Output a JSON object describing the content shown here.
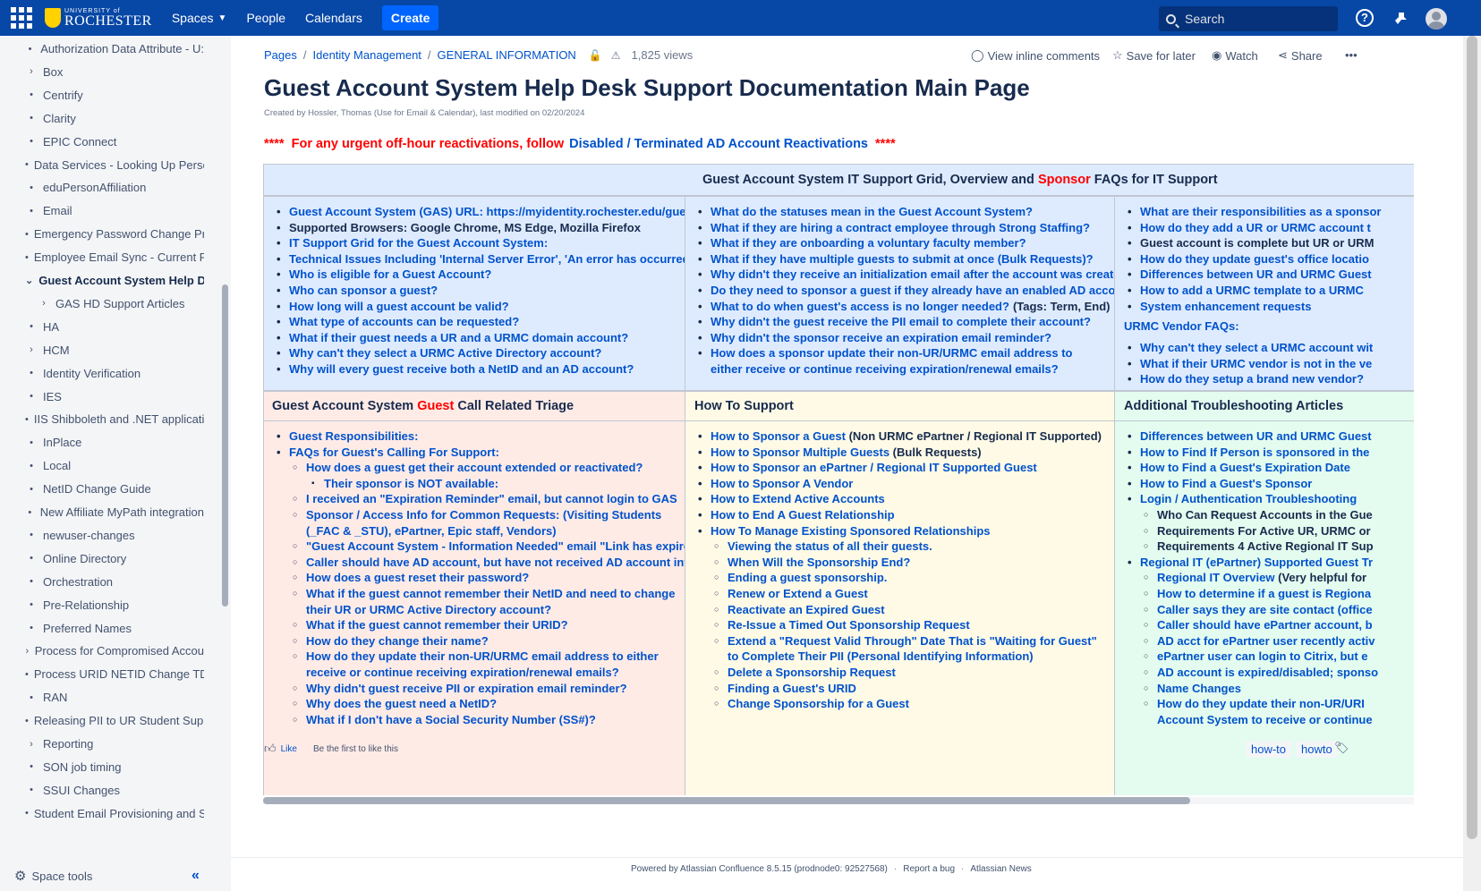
{
  "topbar": {
    "logo_small": "UNIVERSITY of",
    "logo_big": "ROCHESTER",
    "nav": [
      "Spaces",
      "People",
      "Calendars"
    ],
    "create": "Create",
    "search_placeholder": "Search",
    "help": "?"
  },
  "sidebar": {
    "items": [
      {
        "label": "Authorization Data Attribute - U:",
        "marker": "•"
      },
      {
        "label": "Box",
        "marker": "›"
      },
      {
        "label": "Centrify",
        "marker": "•"
      },
      {
        "label": "Clarity",
        "marker": "•"
      },
      {
        "label": "EPIC Connect",
        "marker": "•"
      },
      {
        "label": "Data Services - Looking Up Persc",
        "marker": "•"
      },
      {
        "label": "eduPersonAffiliation",
        "marker": "•"
      },
      {
        "label": "Email",
        "marker": "•"
      },
      {
        "label": "Emergency Password Change Pr",
        "marker": "•"
      },
      {
        "label": "Employee Email Sync - Current P",
        "marker": "•"
      },
      {
        "label": "Guest Account System Help De",
        "marker": "⌄",
        "active": true
      },
      {
        "label": "GAS HD Support Articles",
        "marker": "›",
        "child": true
      },
      {
        "label": "HA",
        "marker": "•"
      },
      {
        "label": "HCM",
        "marker": "›"
      },
      {
        "label": "Identity Verification",
        "marker": "•"
      },
      {
        "label": "IES",
        "marker": "•"
      },
      {
        "label": "IIS Shibboleth and .NET applicati",
        "marker": "•"
      },
      {
        "label": "InPlace",
        "marker": "•"
      },
      {
        "label": "Local",
        "marker": "•"
      },
      {
        "label": "NetID Change Guide",
        "marker": "•"
      },
      {
        "label": "New Affiliate MyPath integration",
        "marker": "•"
      },
      {
        "label": "newuser-changes",
        "marker": "•"
      },
      {
        "label": "Online Directory",
        "marker": "•"
      },
      {
        "label": "Orchestration",
        "marker": "•"
      },
      {
        "label": "Pre-Relationship",
        "marker": "•"
      },
      {
        "label": "Preferred Names",
        "marker": "•"
      },
      {
        "label": "Process for Compromised Accou",
        "marker": "›"
      },
      {
        "label": "Process URID NETID Change TDI",
        "marker": "•"
      },
      {
        "label": "RAN",
        "marker": "•"
      },
      {
        "label": "Releasing PII to UR Student Supp",
        "marker": "•"
      },
      {
        "label": "Reporting",
        "marker": "›"
      },
      {
        "label": "SON job timing",
        "marker": "•"
      },
      {
        "label": "SSUI Changes",
        "marker": "•"
      },
      {
        "label": "Student Email Provisioning and S",
        "marker": "•"
      }
    ],
    "space_tools": "Space tools",
    "collapse": "«"
  },
  "breadcrumb": {
    "items": [
      "Pages",
      "Identity Management",
      "GENERAL INFORMATION"
    ],
    "views": "1,825 views"
  },
  "page_actions": {
    "inline_comments": "View inline comments",
    "save_later": "Save for later",
    "watch": "Watch",
    "share": "Share",
    "more": "•••"
  },
  "page": {
    "title": "Guest Account System Help Desk Support Documentation Main Page",
    "byline": "Created by Hossler, Thomas (Use for Email & Calendar), last modified on 02/20/2024",
    "alert_stars": "****",
    "alert_text": "For any urgent off-hour reactivations, follow",
    "alert_link": "Disabled / Terminated AD Account Reactivations",
    "alert_stars_end": "****"
  },
  "grid": {
    "header_pre": "Guest Account System IT Support Grid, Overview and ",
    "header_red": "Sponsor",
    "header_post": " FAQs for IT Support",
    "col1": [
      "Guest Account System (GAS) URL:   https://myidentity.rochester.edu/guest/",
      "Supported Browsers:  Google Chrome, MS Edge, Mozilla Firefox",
      "IT Support Grid for the Guest Account System:",
      "Technical Issues Including 'Internal Server Error', 'An error has occurred..'",
      "Who is eligible for a Guest Account?",
      "Who can sponsor a guest?",
      "How long will a guest account be valid?",
      "What type of accounts can be requested?",
      "What if their guest needs a UR and a URMC domain account?",
      "Why can't they select a URMC Active Directory account?",
      "Why will every guest receive both a NetID and an AD account?"
    ],
    "col2": [
      "What do the statuses mean in the Guest Account System?",
      "What if they are hiring a contract employee through Strong Staffing?",
      "What if they are onboarding a voluntary faculty member?",
      "What if they have multiple guests to submit at once (Bulk Requests)?",
      "Why didn't they receive an initialization email after the account was created?",
      "Do they need to sponsor a guest if they already have an enabled AD account?",
      "What to do when guest's access is no longer needed?",
      "Why didn't the guest receive the PII email to complete their account?",
      "Why didn't the sponsor receive an expiration email reminder?",
      "How does a sponsor update their non-UR/URMC email address to either receive or continue receiving expiration/renewal emails?"
    ],
    "col2_tags": "(Tags: Term, End)",
    "col3": [
      "What are their responsibilities as a sponsor",
      "How do they add a UR or URMC account t",
      "Guest account is complete but UR or URM",
      "How do they update guest's office locatio",
      "Differences between UR and URMC Guest",
      "How to add a URMC template to a URMC",
      "System enhancement requests"
    ],
    "col3_sub": "URMC Vendor FAQs:",
    "col3b": [
      "Why can't they select a URMC account wit",
      "What if their URMC vendor is not in the ve",
      "How do they setup a brand new vendor?"
    ]
  },
  "triage": {
    "title_pre": "Guest Account System ",
    "title_red": "Guest",
    "title_post": " Call Related Triage",
    "items": [
      {
        "t": "Guest Responsibilities:",
        "lvl": 1
      },
      {
        "t": "FAQs for Guest's Calling For Support:",
        "lvl": 1
      },
      {
        "t": "How does a guest get their account extended or reactivated?",
        "lvl": 2
      },
      {
        "t": "Their sponsor is NOT available:",
        "lvl": 3
      },
      {
        "t": "I received an \"Expiration Reminder\" email, but cannot login to GAS",
        "lvl": 2
      },
      {
        "t": "Sponsor / Access Info for Common Requests: (Visiting Students (_FAC & _STU), ePartner, Epic staff, Vendors)",
        "lvl": 2,
        "wrap": true
      },
      {
        "t": "\"Guest Account System - Information Needed\" email \"Link has expired\"",
        "lvl": 2
      },
      {
        "t": "Caller should have AD account, but have not received AD account info",
        "lvl": 2
      },
      {
        "t": "How does a guest reset their password?",
        "lvl": 2
      },
      {
        "t": "What if the guest cannot remember their NetID and need to change their UR or URMC Active Directory account?",
        "lvl": 2,
        "wrap": true
      },
      {
        "t": "What if the guest cannot remember their URID?",
        "lvl": 2
      },
      {
        "t": "How do they change their name?",
        "lvl": 2
      },
      {
        "t": "How do they update their non-UR/URMC email address to either receive or continue receiving expiration/renewal emails?",
        "lvl": 2,
        "wrap": true
      },
      {
        "t": "Why didn't guest receive PII or expiration email reminder?",
        "lvl": 2
      },
      {
        "t": "Why does the guest need a NetID?",
        "lvl": 2
      },
      {
        "t": "What if I don't have a Social Security Number (SS#)?",
        "lvl": 2
      }
    ]
  },
  "howto": {
    "title": "How To Support",
    "items": [
      {
        "t": "How to Sponsor a Guest",
        "dark": " (Non URMC ePartner / Regional IT Supported)",
        "lvl": 1
      },
      {
        "t": "How to Sponsor Multiple Guests",
        "dark": " (Bulk Requests)",
        "lvl": 1
      },
      {
        "t": "How to Sponsor an ePartner / Regional IT Supported Guest",
        "lvl": 1
      },
      {
        "t": "How to Sponsor A Vendor",
        "lvl": 1
      },
      {
        "t": "How to Extend Active Accounts",
        "lvl": 1
      },
      {
        "t": "How to End A Guest Relationship",
        "lvl": 1
      },
      {
        "t": "How To Manage Existing Sponsored Relationships",
        "lvl": 1
      },
      {
        "t": "Viewing the status of all their guests.",
        "lvl": 2
      },
      {
        "t": "When Will the Sponsorship End?",
        "lvl": 2
      },
      {
        "t": "Ending a guest sponsorship.",
        "lvl": 2
      },
      {
        "t": "Renew or Extend a Guest",
        "lvl": 2
      },
      {
        "t": "Reactivate an Expired Guest",
        "lvl": 2
      },
      {
        "t": "Re-Issue a Timed Out Sponsorship Request",
        "lvl": 2
      },
      {
        "t": "Extend a \"Request Valid Through\" Date That is \"Waiting for Guest\" to Complete Their PII (Personal Identifying Information)",
        "lvl": 2,
        "wrap": true
      },
      {
        "t": "Delete a Sponsorship Request",
        "lvl": 2
      },
      {
        "t": "Finding a Guest's URID",
        "lvl": 2
      },
      {
        "t": "Change Sponsorship for a Guest",
        "lvl": 2
      }
    ]
  },
  "additional": {
    "title": "Additional Troubleshooting Articles",
    "items": [
      {
        "t": "Differences between UR and URMC Guest",
        "lvl": 1
      },
      {
        "t": "How to Find If Person is sponsored in the",
        "lvl": 1
      },
      {
        "t": "How to Find a Guest's Expiration Date",
        "lvl": 1
      },
      {
        "t": "How to Find a Guest's Sponsor",
        "lvl": 1
      },
      {
        "t": "Login / Authentication Troubleshooting",
        "lvl": 1
      },
      {
        "t": "Who Can Request Accounts in the Gue",
        "lvl": 2,
        "dk": true
      },
      {
        "t": "Requirements For Active UR, URMC or",
        "lvl": 2,
        "dk": true
      },
      {
        "t": "Requirements 4 Active Regional IT Sup",
        "lvl": 2,
        "dk": true
      },
      {
        "t": "Regional IT (ePartner) Supported Guest Tr",
        "lvl": 1
      },
      {
        "t": "Regional IT Overview",
        "dark": " (Very helpful for",
        "lvl": 2
      },
      {
        "t": "How to determine if a guest is Regiona",
        "lvl": 2
      },
      {
        "t": "Caller says they are site contact (office",
        "lvl": 2
      },
      {
        "t": "Caller should have ePartner account, b",
        "lvl": 2
      },
      {
        "t": "AD acct for ePartner user recently activ",
        "lvl": 2
      },
      {
        "t": "ePartner user can login to Citrix, but e",
        "lvl": 2
      },
      {
        "t": "AD account is expired/disabled; sponso",
        "lvl": 2
      },
      {
        "t": "Name Changes",
        "lvl": 2
      },
      {
        "t": "How do they update their non-UR/URI",
        "lvl": 2
      },
      {
        "t": "Account System to receive or continue",
        "lvl": 2,
        "cont": true
      }
    ]
  },
  "footer_meta": {
    "like": "Like",
    "first_like": "Be the first to like this",
    "labels": [
      "how-to",
      "howto"
    ]
  },
  "footer": {
    "powered": "Powered by Atlassian Confluence 8.5.15 (prodnode0: 92527568)",
    "bug": "Report a bug",
    "news": "Atlassian News"
  },
  "colors": {
    "topbar": "#0747a6",
    "link": "#0052cc",
    "alert_red": "#ff0000",
    "blue_cell": "#deebff",
    "red_cell": "#ffebe6",
    "yellow_cell": "#fffae6",
    "green_cell": "#e3fcef"
  }
}
